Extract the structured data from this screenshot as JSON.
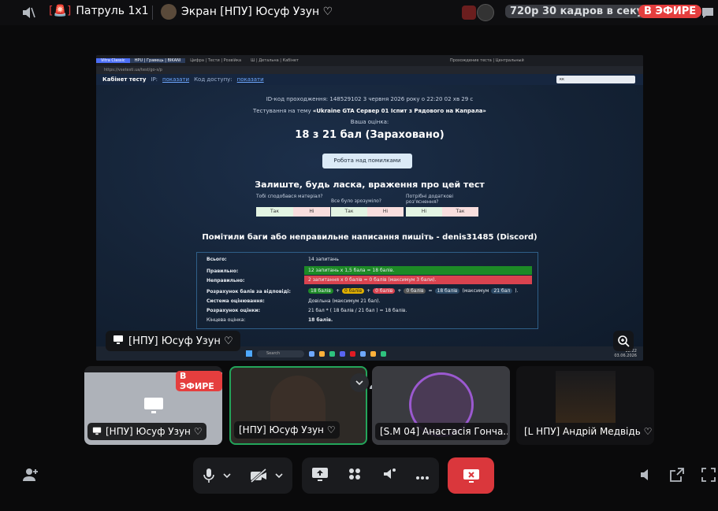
{
  "top_bar": {
    "channel": "Патруль 1х1",
    "screen_title": "Экран [НПУ] Юсуф Узун ♡",
    "quality": "720р 30 кадров в секунду",
    "live": "В ЭФИРЕ"
  },
  "browser": {
    "tab_active": "HPU | Гравець | BIKANI",
    "tab_items": [
      "Vitra Classic",
      "Цифра | Тести | Розвійка",
      "Ш | Детальна | Кабінет",
      "Прохождение теста | Центральный"
    ],
    "address": "https://vsetesti.ua/test/go-s/p",
    "status_items": [
      "Wifi",
      "3 Hz",
      "2707 МГц",
      "14001 МГц"
    ]
  },
  "site": {
    "brand": "Кабінет тесту",
    "ip_label": "IP:",
    "ip_link": "показати",
    "code_label": "Код доступу:",
    "code_link": "показати",
    "user": "кк",
    "id_line": "ID-код проходження: 148529102    3 червня 2026 року о 22:20 02 хв 29 с",
    "theme_prefix": "Тестування на тему",
    "theme": "«Ukraine GTA Сервер 01 Іспит з Рядового на Капрала»",
    "grade_label": "Ваша оцінка:",
    "score": "18 з 21 бал (Зараховано)",
    "work_button": "Робота над помилками",
    "feedback_title": "Залиште, будь ласка, враження про цей тест",
    "fb1_q": "Тобі сподобався матеріал?",
    "fb1_yes": "Так",
    "fb1_no": "Ні",
    "fb2_q": "Все було зрозуміло?",
    "fb2_yes": "Так",
    "fb2_no": "Ні",
    "fb3_q": "Потрібні додаткові роз'яснення?",
    "fb3_yes": "Ні",
    "fb3_no": "Так",
    "bugs": "Помітили баги або неправильне написання пишіть - denis31485 (Discord)",
    "summary": {
      "total_label": "Всього:",
      "total_value": "14 запитань",
      "correct_label": "Правильно:",
      "correct_value": "12 запитань x 1,5 бала = 18 балів.",
      "wrong_label": "Неправильно:",
      "wrong_value": "2 запитання x 0 балів = 0 балів (максимум 3 бали).",
      "calc_label": "Розрахунок балів за відповіді:",
      "calc_a": "18 балів",
      "calc_b": "0 балів",
      "calc_c": "0 балів",
      "calc_d": "0 балів",
      "calc_e": "18 балів",
      "calc_max": "(максимум",
      "calc_f": "21 бал",
      "calc_end": ").",
      "system_label": "Система оцінювання:",
      "system_value": "Довільна (максимум 21 бал).",
      "rating_label": "Розрахунок оцінки:",
      "rating_value": "21 бал * ( 18 балів / 21 бал ) = 18 балів.",
      "final_label": "Кінцева оцінка:",
      "final_value": "18 балів."
    }
  },
  "taskbar": {
    "search": "Search",
    "time": "22:22",
    "date": "03.06.2026"
  },
  "stream_overlay": {
    "name": "[НПУ] Юсуф Узун ♡"
  },
  "tiles": [
    {
      "name": "[НПУ] Юсуф Узун ♡",
      "badge": "В ЭФИРЕ"
    },
    {
      "name": "[НПУ] Юсуф Узун ♡"
    },
    {
      "name": "[S.M 04] Анастасія Гонча..."
    },
    {
      "name": "[L НПУ] Андрій Медвідь ♡"
    }
  ],
  "colors": {
    "live": "#e53e3e",
    "accent_green": "#23a55a",
    "danger": "#da373c"
  }
}
